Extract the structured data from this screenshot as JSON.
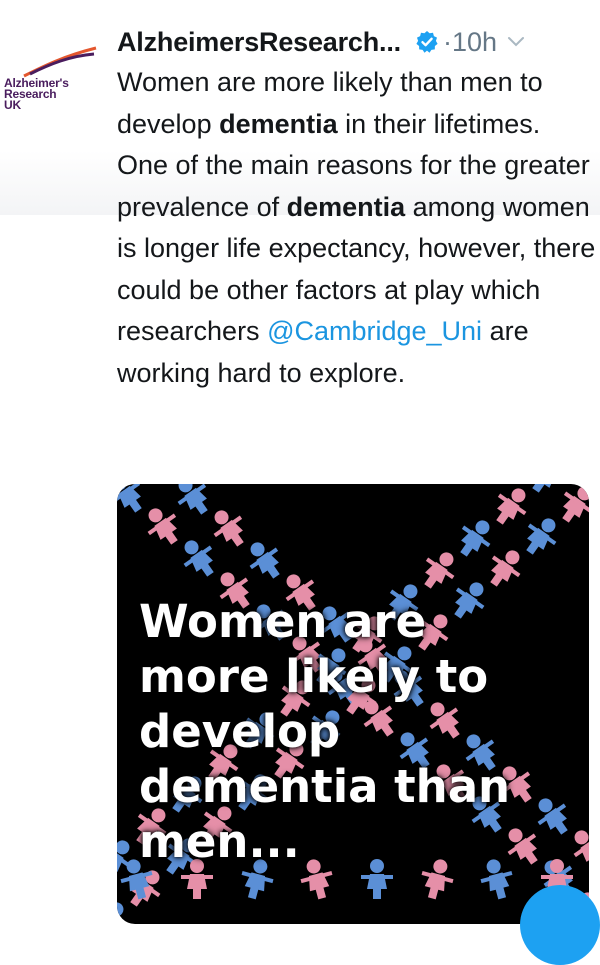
{
  "account": {
    "name": "AlzheimersResearch...",
    "time": "·10h",
    "logo_lines": [
      "Alzheimer's",
      "Research",
      "UK"
    ]
  },
  "tweet": {
    "p1": "Women are more likely than men to develop ",
    "b1": "dementia",
    "p2": " in their lifetimes. One of the main reasons for the greater prevalence of ",
    "b2": "dementia",
    "p3": " among women is longer life expectancy, however, there could be other factors at play which researchers ",
    "mention": "@Cambridge_Uni",
    "p4": " are working hard to explore."
  },
  "media": {
    "lines": [
      "Women are",
      "more likely to",
      "develop",
      "dementia than",
      "men..."
    ]
  },
  "colors": {
    "link": "#1b95e0",
    "pink_figure": "#e58fa8",
    "blue_figure": "#5b8fd6",
    "verified": "#1da1f2"
  }
}
